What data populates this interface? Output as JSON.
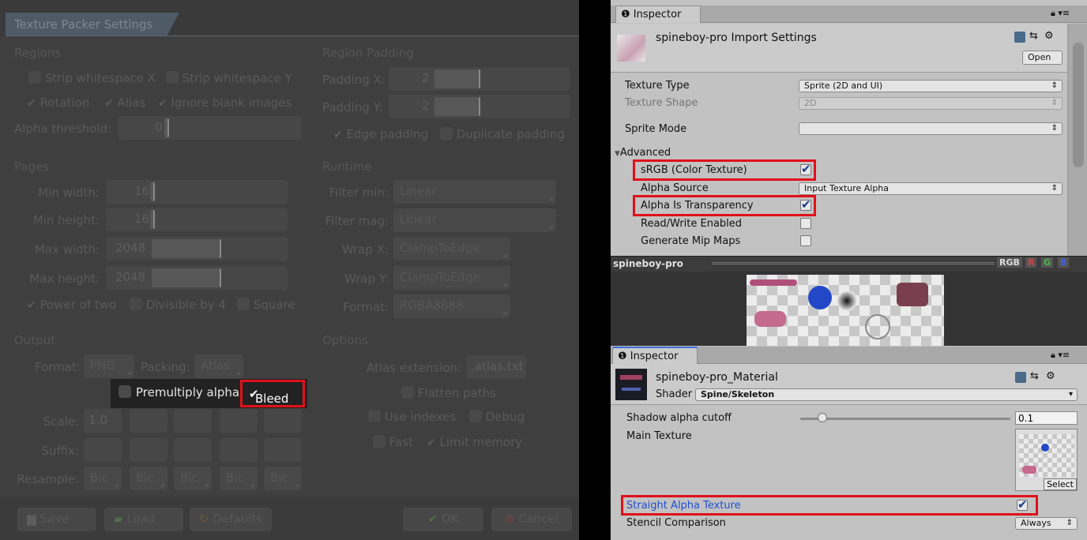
{
  "packer": {
    "title": "Texture Packer Settings",
    "regions": {
      "heading": "Regions",
      "strip_x": "Strip whitespace X",
      "strip_y": "Strip whitespace Y",
      "rotation": "Rotation",
      "alias": "Alias",
      "ignore_blank": "Ignore blank images",
      "alpha_threshold_label": "Alpha threshold:",
      "alpha_threshold_value": "0"
    },
    "region_padding": {
      "heading": "Region Padding",
      "padding_x_label": "Padding X:",
      "padding_x_value": "2",
      "padding_y_label": "Padding Y:",
      "padding_y_value": "2",
      "edge_padding": "Edge padding",
      "duplicate_padding": "Duplicate padding"
    },
    "pages": {
      "heading": "Pages",
      "min_width_label": "Min width:",
      "min_width_value": "16",
      "min_height_label": "Min height:",
      "min_height_value": "16",
      "max_width_label": "Max width:",
      "max_width_value": "2048",
      "max_height_label": "Max height:",
      "max_height_value": "2048",
      "power_of_two": "Power of two",
      "divisible_by_4": "Divisible by 4",
      "square": "Square"
    },
    "runtime": {
      "heading": "Runtime",
      "filter_min_label": "Filter min:",
      "filter_min_value": "Linear",
      "filter_mag_label": "Filter mag:",
      "filter_mag_value": "Linear",
      "wrap_x_label": "Wrap X:",
      "wrap_x_value": "ClampToEdge",
      "wrap_y_label": "Wrap Y:",
      "wrap_y_value": "ClampToEdge",
      "format_label": "Format:",
      "format_value": "RGBA8888"
    },
    "output": {
      "heading": "Output",
      "format_label": "Format:",
      "format_value": "PNG",
      "packing_label": "Packing:",
      "packing_value": "Atlas",
      "premultiply_alpha": "Premultiply alpha",
      "bleed": "Bleed",
      "scale_label": "Scale:",
      "scale_value": "1.0",
      "suffix_label": "Suffix:",
      "resample_label": "Resample:",
      "resample_values": [
        "Bic",
        "Bic",
        "Bic",
        "Bic",
        "Bic"
      ]
    },
    "options": {
      "heading": "Options",
      "atlas_extension_label": "Atlas extension:",
      "atlas_extension_value": ".atlas.txt",
      "flatten_paths": "Flatten paths",
      "use_indexes": "Use indexes",
      "debug": "Debug",
      "fast": "Fast",
      "limit_memory": "Limit memory"
    },
    "buttons": {
      "save": "Save",
      "load": "Load",
      "defaults": "Defaults",
      "ok": "OK",
      "cancel": "Cancel"
    }
  },
  "import_inspector": {
    "tab": "Inspector",
    "title": "spineboy-pro Import Settings",
    "open": "Open",
    "texture_type_label": "Texture Type",
    "texture_type_value": "Sprite (2D and UI)",
    "texture_shape_label": "Texture Shape",
    "texture_shape_value": "2D",
    "sprite_mode_label": "Sprite Mode",
    "sprite_mode_value": "",
    "advanced": "Advanced",
    "srgb_label": "sRGB (Color Texture)",
    "srgb_checked": true,
    "alpha_source_label": "Alpha Source",
    "alpha_source_value": "Input Texture Alpha",
    "alpha_transparency_label": "Alpha Is Transparency",
    "alpha_transparency_checked": true,
    "read_write_label": "Read/Write Enabled",
    "read_write_checked": false,
    "mipmaps_label": "Generate Mip Maps",
    "mipmaps_checked": false
  },
  "preview": {
    "name": "spineboy-pro",
    "channels": [
      "RGB",
      "R",
      "G",
      "B"
    ]
  },
  "material_inspector": {
    "tab": "Inspector",
    "title": "spineboy-pro_Material",
    "shader_label": "Shader",
    "shader_value": "Spine/Skeleton",
    "shadow_cutoff_label": "Shadow alpha cutoff",
    "shadow_cutoff_value": "0.1",
    "main_texture_label": "Main Texture",
    "select": "Select",
    "straight_alpha_label": "Straight Alpha Texture",
    "straight_alpha_checked": true,
    "stencil_label": "Stencil Comparison",
    "stencil_value": "Always"
  },
  "colors": {
    "highlight": "#e0101a",
    "checkmark": "#1b3a8a",
    "link_blue": "#1f4fd0"
  }
}
